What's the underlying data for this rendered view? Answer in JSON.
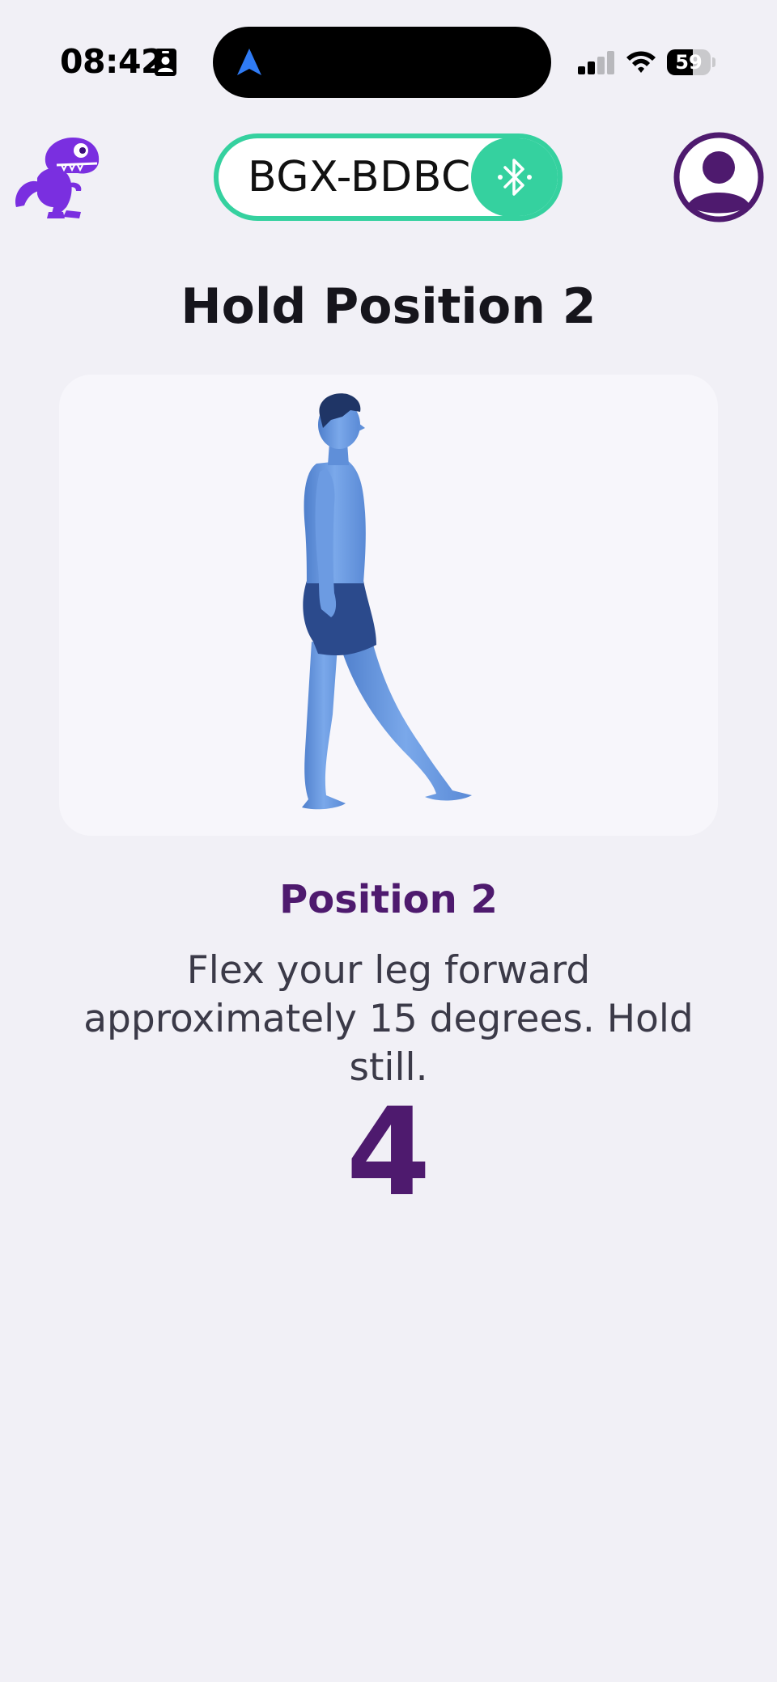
{
  "status_bar": {
    "time": "08:42",
    "battery_percent": 59,
    "battery_text": "59",
    "icons": [
      "contact-card-icon",
      "navigation-arrow-icon",
      "cellular-signal-icon",
      "wifi-icon",
      "battery-icon"
    ]
  },
  "header": {
    "logo_icon": "dinosaur-logo-icon",
    "device_name": "BGX-BDBC",
    "bluetooth_icon": "bluetooth-icon",
    "profile_icon": "user-profile-icon"
  },
  "page": {
    "title": "Hold Position 2",
    "figure_icon": "human-figure-leg-forward",
    "position_label": "Position 2",
    "instruction": "Flex your leg forward approximately 15 degrees. Hold still.",
    "countdown": "4"
  },
  "colors": {
    "background": "#f1f0f6",
    "accent_green": "#35d19f",
    "brand_purple": "#4e1a6e",
    "logo_purple": "#7a2fe0",
    "figure_blue": "#5b8fd8"
  }
}
